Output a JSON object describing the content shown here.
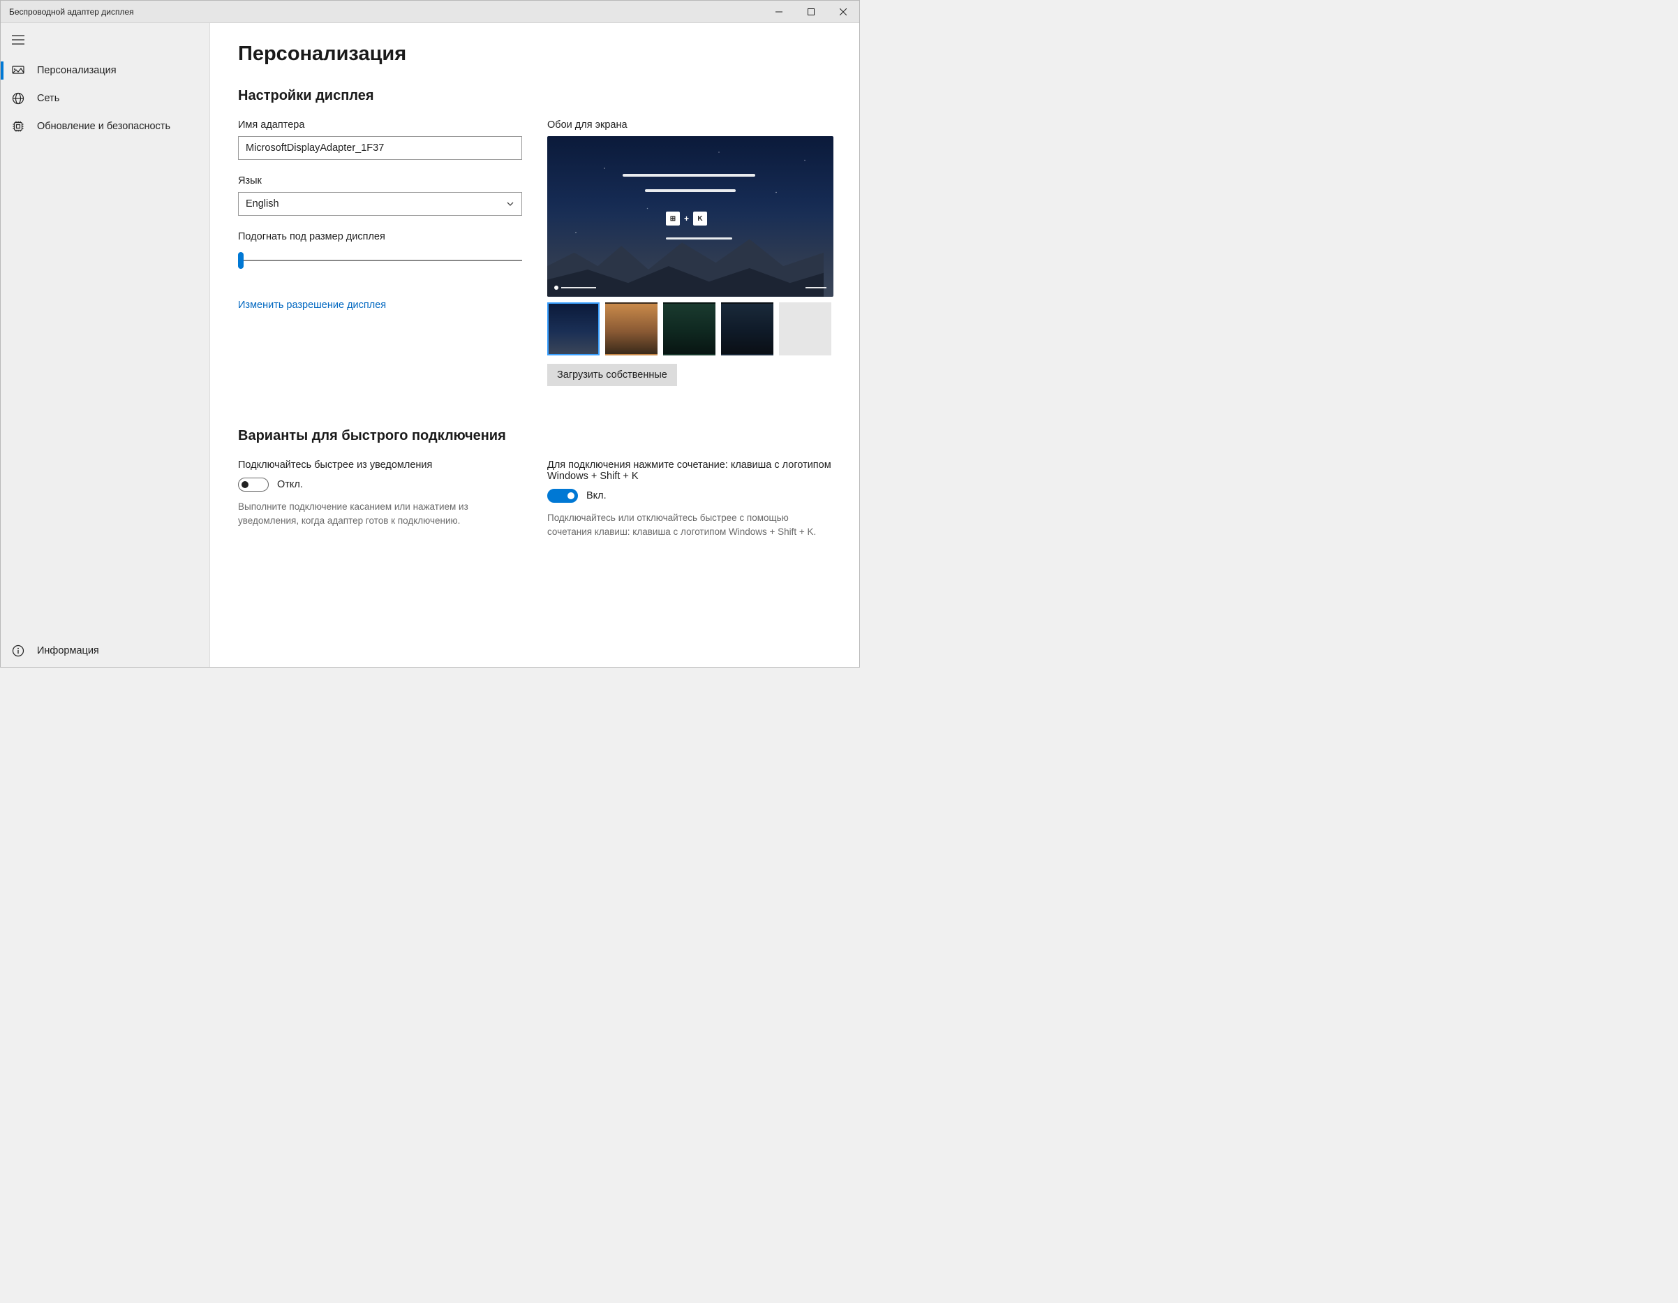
{
  "window": {
    "title": "Беспроводной адаптер дисплея"
  },
  "sidebar": {
    "items": [
      {
        "label": "Персонализация",
        "icon": "personalize-icon"
      },
      {
        "label": "Сеть",
        "icon": "globe-icon"
      },
      {
        "label": "Обновление и безопасность",
        "icon": "chip-icon"
      }
    ],
    "footer": {
      "label": "Информация",
      "icon": "info-icon"
    }
  },
  "page": {
    "title": "Персонализация",
    "display_settings_heading": "Настройки дисплея",
    "adapter_name": {
      "label": "Имя адаптера",
      "value": "MicrosoftDisplayAdapter_1F37"
    },
    "language": {
      "label": "Язык",
      "value": "English"
    },
    "fit_display": {
      "label": "Подогнать под размер дисплея",
      "value": 0
    },
    "change_resolution_link": "Изменить разрешение дисплея",
    "wallpaper": {
      "label": "Обои для экрана",
      "shortcut_key1": "⊞",
      "shortcut_plus": "+",
      "shortcut_key2": "K",
      "upload_button": "Загрузить собственные"
    },
    "quick_connect": {
      "heading": "Варианты для быстрого подключения",
      "notif": {
        "label": "Подключайтесь быстрее из уведомления",
        "state_label": "Откл.",
        "helper": "Выполните подключение касанием или нажатием из уведомления, когда адаптер готов к подключению."
      },
      "hotkey": {
        "label": "Для подключения нажмите сочетание: клавиша с логотипом Windows + Shift + K",
        "state_label": "Вкл.",
        "helper": "Подключайтесь или отключайтесь быстрее с помощью сочетания клавиш: клавиша с логотипом Windows + Shift + K."
      }
    }
  }
}
